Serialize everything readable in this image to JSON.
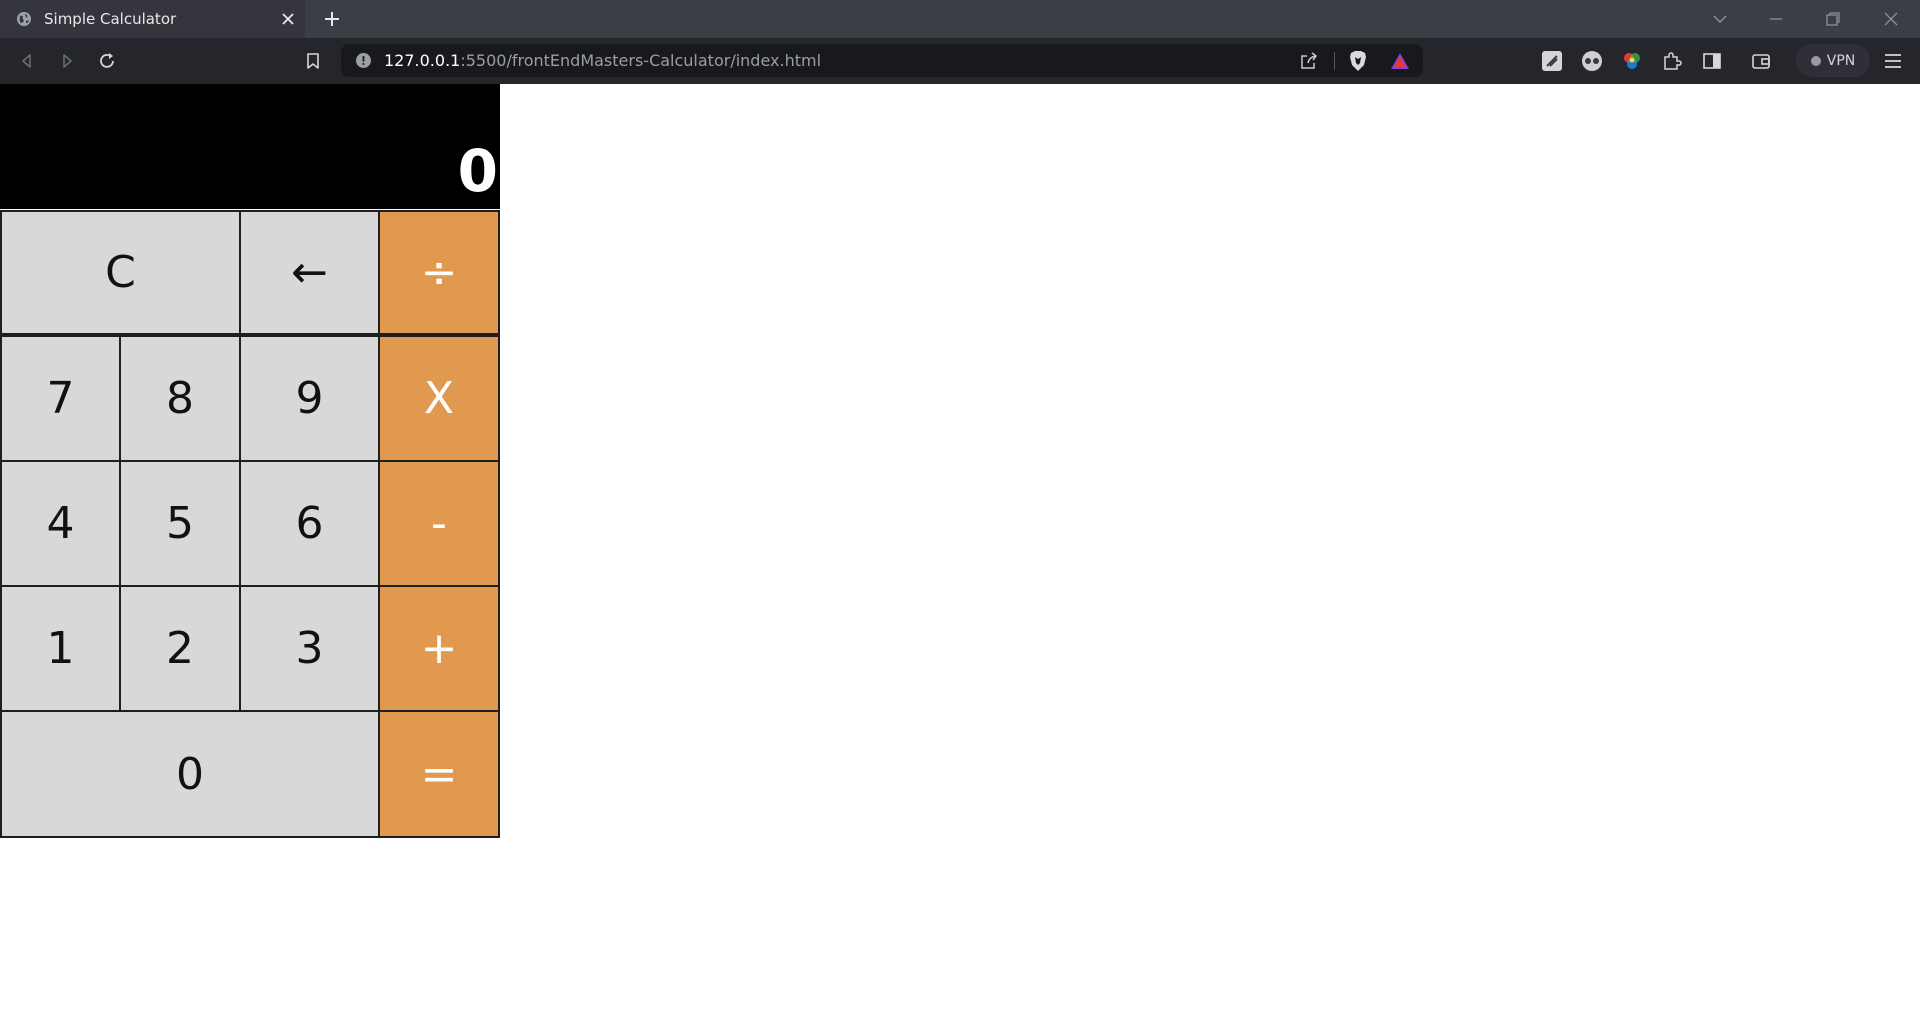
{
  "browser": {
    "tab": {
      "title": "Simple Calculator",
      "favicon": "globe-icon"
    },
    "address": {
      "host": "127.0.0.1",
      "rest": ":5500/frontEndMasters-Calculator/index.html"
    },
    "vpn_label": "VPN",
    "icons": [
      "back-icon",
      "forward-icon",
      "reload-icon",
      "bookmark-icon",
      "site-info-icon",
      "share-icon",
      "brave-shield-icon",
      "brave-rewards-icon",
      "extension-icon",
      "puzzle-icon",
      "sidebar-icon",
      "wallet-icon",
      "menu-icon"
    ]
  },
  "calculator": {
    "display": "0",
    "keys": {
      "clear": "C",
      "backspace": "←",
      "divide": "÷",
      "seven": "7",
      "eight": "8",
      "nine": "9",
      "multiply": "X",
      "four": "4",
      "five": "5",
      "six": "6",
      "minus": "-",
      "one": "1",
      "two": "2",
      "three": "3",
      "plus": "+",
      "zero": "0",
      "equals": "="
    },
    "colors": {
      "display_bg": "#000000",
      "key_bg": "#d8d8d8",
      "operator_bg": "#e0994e",
      "operator_text": "#ffffff"
    }
  }
}
